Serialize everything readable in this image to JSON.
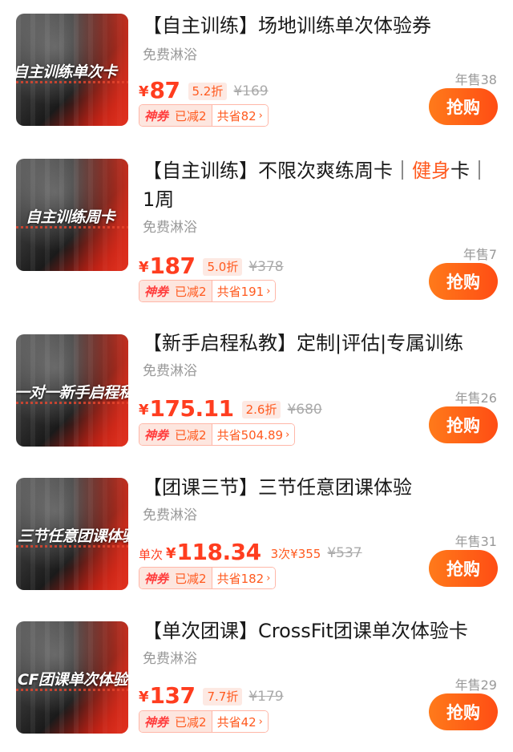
{
  "items": [
    {
      "thumb_text": "自主训练单次卡",
      "title": "【自主训练】场地训练单次体验券",
      "subtitle": "免费淋浴",
      "price_prefix": "",
      "currency": "¥",
      "price": "87",
      "discount": "5.2折",
      "original_price": "¥169",
      "coupon_tag": "神券",
      "coupon_reduced": "已减2",
      "coupon_save": "共省82",
      "sold": "年售38",
      "buy_label": "抢购"
    },
    {
      "thumb_text": "自主训练周卡",
      "title_parts": [
        "【自主训练】不限次爽练周卡｜",
        "健身",
        "卡｜1周"
      ],
      "subtitle": "免费淋浴",
      "price_prefix": "",
      "currency": "¥",
      "price": "187",
      "discount": "5.0折",
      "original_price": "¥378",
      "coupon_tag": "神券",
      "coupon_reduced": "已减2",
      "coupon_save": "共省191",
      "sold": "年售7",
      "buy_label": "抢购"
    },
    {
      "thumb_text": "一对一新手启程私教",
      "title": "【新手启程私教】定制|评估|专属训练",
      "subtitle": "免费淋浴",
      "price_prefix": "",
      "currency": "¥",
      "price": "175.11",
      "discount": "2.6折",
      "original_price": "¥680",
      "coupon_tag": "神券",
      "coupon_reduced": "已减2",
      "coupon_save": "共省504.89",
      "sold": "年售26",
      "buy_label": "抢购"
    },
    {
      "thumb_text": "三节任意团课体验",
      "title": "【团课三节】三节任意团课体验",
      "subtitle": "免费淋浴",
      "price_prefix": "单次",
      "currency": "¥",
      "price": "118.34",
      "discount": "3次¥355",
      "original_price": "¥537",
      "coupon_tag": "神券",
      "coupon_reduced": "已减2",
      "coupon_save": "共省182",
      "sold": "年售31",
      "buy_label": "抢购"
    },
    {
      "thumb_text": "CF团课单次体验",
      "title": "【单次团课】CrossFit团课单次体验卡",
      "subtitle": "免费淋浴",
      "price_prefix": "",
      "currency": "¥",
      "price": "137",
      "discount": "7.7折",
      "original_price": "¥179",
      "coupon_tag": "神券",
      "coupon_reduced": "已减2",
      "coupon_save": "共省42",
      "sold": "年售29",
      "buy_label": "抢购"
    }
  ],
  "colors": {
    "accent": "#ff3d1f",
    "button_start": "#ff7a1a",
    "button_end": "#ff4d14",
    "muted": "#999999"
  },
  "icons": {
    "coupon_arrow": "chevron-right-icon"
  }
}
